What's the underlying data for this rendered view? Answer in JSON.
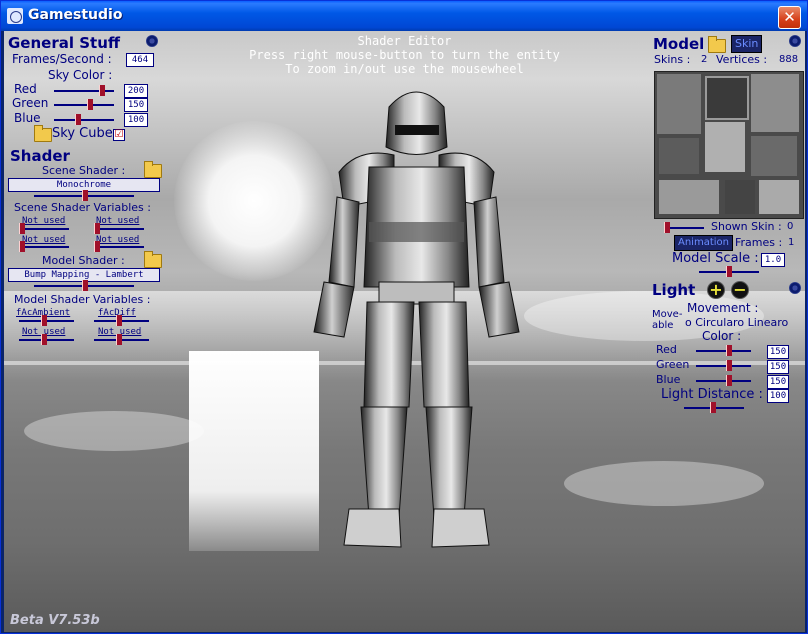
{
  "window": {
    "title": "Gamestudio",
    "close_glyph": "✕"
  },
  "overlay": {
    "line1": "Shader Editor",
    "line2": "Press right mouse-button to turn the entity",
    "line3": "To zoom in/out use the mousewheel",
    "version": "Beta V7.53b"
  },
  "general": {
    "heading": "General Stuff",
    "fps_label": "Frames/Second :",
    "fps_value": "464",
    "sky_color_label": "Sky Color :",
    "red_label": "Red",
    "red_value": "200",
    "red_level": 0.78,
    "green_label": "Green",
    "green_value": "150",
    "green_level": 0.59,
    "blue_label": "Blue",
    "blue_value": "100",
    "blue_level": 0.39,
    "sky_cube_label": "Sky Cube",
    "sky_cube_checked": "☑"
  },
  "shader": {
    "heading": "Shader",
    "scene_shader_label": "Scene Shader :",
    "scene_shader_value": "Monochrome",
    "scene_vars_label": "Scene Shader Variables :",
    "scene_vars": [
      "Not used",
      "Not used",
      "Not used",
      "Not used"
    ],
    "model_shader_label": "Model Shader :",
    "model_shader_value": "Bump Mapping - Lambert",
    "model_vars_label": "Model Shader Variables :",
    "model_vars": [
      "fAcAmbient",
      "fAcDiff",
      "Not used",
      "Not used"
    ]
  },
  "model": {
    "heading": "Model",
    "skin_button": "Skin",
    "skins_label": "Skins :",
    "skins_value": "2",
    "vertices_label": "Vertices :",
    "vertices_value": "888",
    "shown_skin_label": "Shown Skin :",
    "shown_skin_value": "0",
    "animation_button": "Animation",
    "frames_label": "Frames :",
    "frames_value": "1",
    "scale_label": "Model Scale :",
    "scale_value": "1.0"
  },
  "light": {
    "heading": "Light",
    "plus": "+",
    "minus": "−",
    "movement_label": "Movement :",
    "moveable_label": "Move-able",
    "movement_options": "o Circularo Linearo",
    "color_label": "Color :",
    "red_label": "Red",
    "red_value": "150",
    "red_level": 0.59,
    "green_label": "Green",
    "green_value": "150",
    "green_level": 0.59,
    "blue_label": "Blue",
    "blue_value": "150",
    "blue_level": 0.59,
    "distance_label": "Light Distance :",
    "distance_value": "100"
  },
  "icons": {
    "gear": "gear-icon",
    "folder": "folder-icon"
  }
}
